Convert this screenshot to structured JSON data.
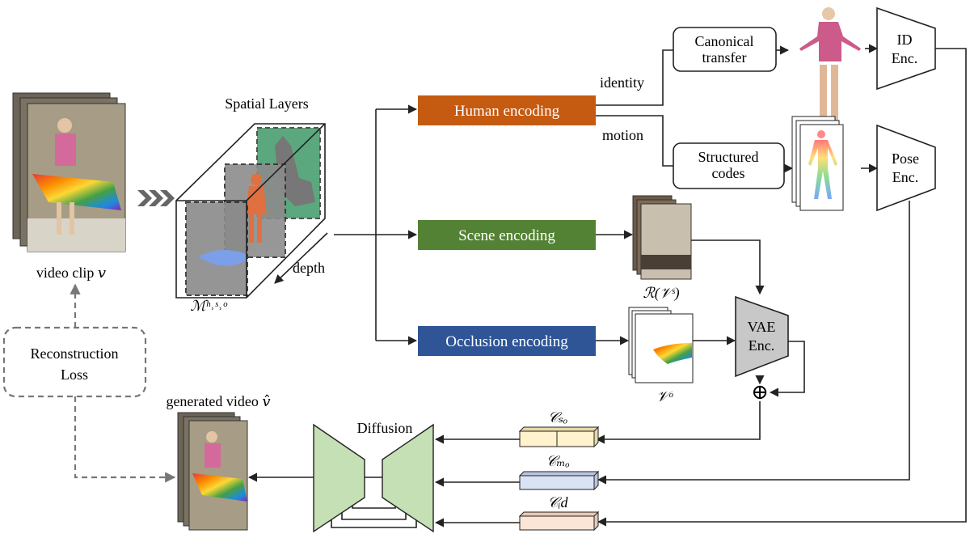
{
  "inputs": {
    "video_clip_label": "video clip 𝑣",
    "spatial_layers_title": "Spatial Layers",
    "mask_label": "ℳʰ˒ˢ˒ᵒ",
    "depth_label": "depth"
  },
  "encoders": {
    "human": {
      "label": "Human encoding",
      "color": "#C55A11"
    },
    "scene": {
      "label": "Scene encoding",
      "color": "#548235"
    },
    "occlusion": {
      "label": "Occlusion encoding",
      "color": "#2F5597"
    }
  },
  "branches": {
    "identity": "identity",
    "motion": "motion"
  },
  "blocks": {
    "canonical": [
      "Canonical",
      "transfer"
    ],
    "structured": [
      "Structured",
      "codes"
    ],
    "id_enc": [
      "ID",
      "Enc."
    ],
    "pose_enc": [
      "Pose",
      "Enc."
    ],
    "vae_enc": [
      "VAE",
      "Enc."
    ],
    "plus": "⊕",
    "diffusion": "Diffusion"
  },
  "features": {
    "scene_label": "ℛ(𝒱ˢ)",
    "occlusion_label": "𝒱ᵒ"
  },
  "conditions": [
    {
      "label": "𝒞ₛₒ",
      "color": "#FFF2CC"
    },
    {
      "label": "𝒞ₘₒ",
      "color": "#DAE3F3"
    },
    {
      "label": "𝒞ᵢd",
      "color": "#FBE5D6"
    }
  ],
  "output": {
    "generated_label": "generated video  𝑣̂"
  },
  "loss": {
    "label": [
      "Reconstruction",
      "Loss"
    ]
  }
}
